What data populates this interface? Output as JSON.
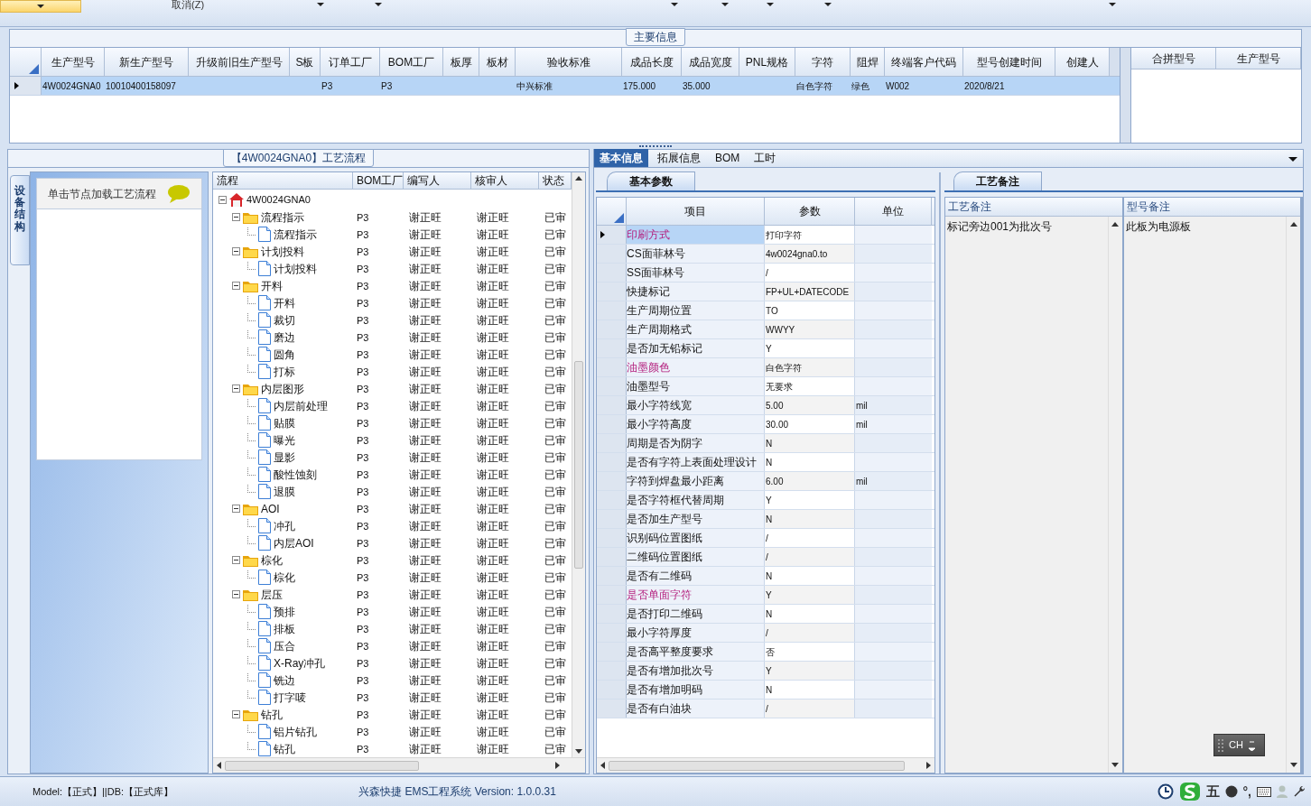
{
  "toolbar": {
    "cancel_label": "取消(Z)"
  },
  "main_info": {
    "title": "主要信息",
    "columns": [
      "生产型号",
      "新生产型号",
      "升级前旧生产型号",
      "S板",
      "订单工厂",
      "BOM工厂",
      "板厚",
      "板材",
      "验收标准",
      "成品长度",
      "成品宽度",
      "PNL规格",
      "字符",
      "阻焊",
      "终端客户代码",
      "型号创建时间",
      "创建人"
    ],
    "rows": [
      {
        "selected": true,
        "cells": [
          "4W0024GNA0",
          "10010400158097",
          null,
          null,
          "P3",
          "P3",
          null,
          null,
          "中兴标准",
          "175.000",
          "35.000",
          null,
          "白色字符",
          "绿色",
          "W002",
          "2020/8/21",
          null
        ]
      }
    ],
    "merge_columns": [
      "合拼型号",
      "生产型号"
    ]
  },
  "process": {
    "title": "【4W0024GNA0】工艺流程",
    "side_tab": "设备结构",
    "hint": "单击节点加载工艺流程",
    "columns": [
      "流程",
      "BOM工厂",
      "编写人",
      "核审人",
      "状态"
    ],
    "rows": [
      {
        "kind": "root",
        "label": "4W0024GNA0",
        "expanded": true,
        "children": [
          {
            "kind": "folder",
            "label": "流程指示",
            "bom": "P3",
            "writer": "谢正旺",
            "reviewer": "谢正旺",
            "status": "已审",
            "expanded": true,
            "children": [
              {
                "kind": "step",
                "label": "流程指示",
                "bom": "P3",
                "writer": "谢正旺",
                "reviewer": "谢正旺",
                "status": "已审"
              }
            ]
          },
          {
            "kind": "folder",
            "label": "计划投料",
            "bom": "P3",
            "writer": "谢正旺",
            "reviewer": "谢正旺",
            "status": "已审",
            "expanded": true,
            "children": [
              {
                "kind": "step",
                "label": "计划投料",
                "bom": "P3",
                "writer": "谢正旺",
                "reviewer": "谢正旺",
                "status": "已审"
              }
            ]
          },
          {
            "kind": "folder",
            "label": "开料",
            "bom": "P3",
            "writer": "谢正旺",
            "reviewer": "谢正旺",
            "status": "已审",
            "expanded": true,
            "children": [
              {
                "kind": "step",
                "label": "开料",
                "bom": "P3",
                "writer": "谢正旺",
                "reviewer": "谢正旺",
                "status": "已审"
              },
              {
                "kind": "step",
                "label": "裁切",
                "bom": "P3",
                "writer": "谢正旺",
                "reviewer": "谢正旺",
                "status": "已审"
              },
              {
                "kind": "step",
                "label": "磨边",
                "bom": "P3",
                "writer": "谢正旺",
                "reviewer": "谢正旺",
                "status": "已审"
              },
              {
                "kind": "step",
                "label": "圆角",
                "bom": "P3",
                "writer": "谢正旺",
                "reviewer": "谢正旺",
                "status": "已审"
              },
              {
                "kind": "step",
                "label": "打标",
                "bom": "P3",
                "writer": "谢正旺",
                "reviewer": "谢正旺",
                "status": "已审"
              }
            ]
          },
          {
            "kind": "folder",
            "label": "内层图形",
            "bom": "P3",
            "writer": "谢正旺",
            "reviewer": "谢正旺",
            "status": "已审",
            "expanded": true,
            "children": [
              {
                "kind": "step",
                "label": "内层前处理",
                "bom": "P3",
                "writer": "谢正旺",
                "reviewer": "谢正旺",
                "status": "已审"
              },
              {
                "kind": "step",
                "label": "贴膜",
                "bom": "P3",
                "writer": "谢正旺",
                "reviewer": "谢正旺",
                "status": "已审"
              },
              {
                "kind": "step",
                "label": "曝光",
                "bom": "P3",
                "writer": "谢正旺",
                "reviewer": "谢正旺",
                "status": "已审"
              },
              {
                "kind": "step",
                "label": "显影",
                "bom": "P3",
                "writer": "谢正旺",
                "reviewer": "谢正旺",
                "status": "已审"
              },
              {
                "kind": "step",
                "label": "酸性蚀刻",
                "bom": "P3",
                "writer": "谢正旺",
                "reviewer": "谢正旺",
                "status": "已审"
              },
              {
                "kind": "step",
                "label": "退膜",
                "bom": "P3",
                "writer": "谢正旺",
                "reviewer": "谢正旺",
                "status": "已审"
              }
            ]
          },
          {
            "kind": "folder",
            "label": "AOI",
            "bom": "P3",
            "writer": "谢正旺",
            "reviewer": "谢正旺",
            "status": "已审",
            "expanded": true,
            "children": [
              {
                "kind": "step",
                "label": "冲孔",
                "bom": "P3",
                "writer": "谢正旺",
                "reviewer": "谢正旺",
                "status": "已审"
              },
              {
                "kind": "step",
                "label": "内层AOI",
                "bom": "P3",
                "writer": "谢正旺",
                "reviewer": "谢正旺",
                "status": "已审"
              }
            ]
          },
          {
            "kind": "folder",
            "label": "棕化",
            "bom": "P3",
            "writer": "谢正旺",
            "reviewer": "谢正旺",
            "status": "已审",
            "expanded": true,
            "children": [
              {
                "kind": "step",
                "label": "棕化",
                "bom": "P3",
                "writer": "谢正旺",
                "reviewer": "谢正旺",
                "status": "已审"
              }
            ]
          },
          {
            "kind": "folder",
            "label": "层压",
            "bom": "P3",
            "writer": "谢正旺",
            "reviewer": "谢正旺",
            "status": "已审",
            "expanded": true,
            "children": [
              {
                "kind": "step",
                "label": "预排",
                "bom": "P3",
                "writer": "谢正旺",
                "reviewer": "谢正旺",
                "status": "已审"
              },
              {
                "kind": "step",
                "label": "排板",
                "bom": "P3",
                "writer": "谢正旺",
                "reviewer": "谢正旺",
                "status": "已审"
              },
              {
                "kind": "step",
                "label": "压合",
                "bom": "P3",
                "writer": "谢正旺",
                "reviewer": "谢正旺",
                "status": "已审"
              },
              {
                "kind": "step",
                "label": "X-Ray冲孔",
                "bom": "P3",
                "writer": "谢正旺",
                "reviewer": "谢正旺",
                "status": "已审"
              },
              {
                "kind": "step",
                "label": "铣边",
                "bom": "P3",
                "writer": "谢正旺",
                "reviewer": "谢正旺",
                "status": "已审"
              },
              {
                "kind": "step",
                "label": "打字唛",
                "bom": "P3",
                "writer": "谢正旺",
                "reviewer": "谢正旺",
                "status": "已审"
              }
            ]
          },
          {
            "kind": "folder",
            "label": "钻孔",
            "bom": "P3",
            "writer": "谢正旺",
            "reviewer": "谢正旺",
            "status": "已审",
            "expanded": true,
            "children": [
              {
                "kind": "step",
                "label": "铝片钻孔",
                "bom": "P3",
                "writer": "谢正旺",
                "reviewer": "谢正旺",
                "status": "已审"
              },
              {
                "kind": "step",
                "label": "钻孔",
                "bom": "P3",
                "writer": "谢正旺",
                "reviewer": "谢正旺",
                "status": "已审"
              }
            ]
          }
        ]
      }
    ]
  },
  "detail_tabs": [
    {
      "label": "基本信息",
      "selected": true
    },
    {
      "label": "拓展信息",
      "selected": false
    },
    {
      "label": "BOM",
      "selected": false
    },
    {
      "label": "工时",
      "selected": false
    }
  ],
  "params": {
    "tab": "基本参数",
    "columns": [
      "项目",
      "参数",
      "单位"
    ],
    "rows": [
      {
        "item": "印刷方式",
        "value": "打印字符",
        "highlighted": true,
        "selected": true
      },
      {
        "item": "CS面菲林号",
        "value": "4w0024gna0.to",
        "highlighted": false,
        "selected": false
      },
      {
        "item": "SS面菲林号",
        "value": "/",
        "highlighted": false,
        "selected": false
      },
      {
        "item": "快捷标记",
        "value": "FP+UL+DATECODE",
        "highlighted": false,
        "selected": false
      },
      {
        "item": "生产周期位置",
        "value": "TO",
        "highlighted": false,
        "selected": false
      },
      {
        "item": "生产周期格式",
        "value": "WWYY",
        "highlighted": false,
        "selected": false
      },
      {
        "item": "是否加无铅标记",
        "value": "Y",
        "highlighted": false,
        "selected": false
      },
      {
        "item": "油墨颜色",
        "value": "白色字符",
        "highlighted": true,
        "selected": false
      },
      {
        "item": "油墨型号",
        "value": "无要求",
        "highlighted": false,
        "selected": false
      },
      {
        "item": "最小字符线宽",
        "value": "5.00",
        "unit": "mil",
        "highlighted": false,
        "selected": false
      },
      {
        "item": "最小字符高度",
        "value": "30.00",
        "unit": "mil",
        "highlighted": false,
        "selected": false
      },
      {
        "item": "周期是否为阴字",
        "value": "N",
        "highlighted": false,
        "selected": false
      },
      {
        "item": "是否有字符上表面处理设计",
        "value": "N",
        "highlighted": false,
        "selected": false
      },
      {
        "item": "字符到焊盘最小距离",
        "value": "6.00",
        "unit": "mil",
        "highlighted": false,
        "selected": false
      },
      {
        "item": "是否字符框代替周期",
        "value": "Y",
        "highlighted": false,
        "selected": false
      },
      {
        "item": "是否加生产型号",
        "value": "N",
        "highlighted": false,
        "selected": false
      },
      {
        "item": "识别码位置图纸",
        "value": "/",
        "highlighted": false,
        "selected": false
      },
      {
        "item": "二维码位置图纸",
        "value": "/",
        "highlighted": false,
        "selected": false
      },
      {
        "item": "是否有二维码",
        "value": "N",
        "highlighted": false,
        "selected": false
      },
      {
        "item": "是否单面字符",
        "value": "Y",
        "highlighted": true,
        "selected": false
      },
      {
        "item": "是否打印二维码",
        "value": "N",
        "highlighted": false,
        "selected": false
      },
      {
        "item": "最小字符厚度",
        "value": "/",
        "highlighted": false,
        "selected": false
      },
      {
        "item": "是否高平整度要求",
        "value": "否",
        "highlighted": false,
        "selected": false
      },
      {
        "item": "是否有增加批次号",
        "value": "Y",
        "highlighted": false,
        "selected": false
      },
      {
        "item": "是否有增加明码",
        "value": "N",
        "highlighted": false,
        "selected": false
      },
      {
        "item": "是否有白油块",
        "value": "/",
        "highlighted": false,
        "selected": false
      }
    ]
  },
  "notes": {
    "tab": "工艺备注",
    "memos": [
      {
        "header": "工艺备注",
        "text": "标记旁边001为批次号"
      },
      {
        "header": "型号备注",
        "text": "此板为电源板"
      }
    ]
  },
  "ime": {
    "label": "CH"
  },
  "status_bar": {
    "model": "Model:【正式】||DB:【正式库】",
    "app": "兴森快捷 EMS工程系统 Version: 1.0.0.31",
    "tray_texts": [
      "五",
      "°,"
    ]
  }
}
